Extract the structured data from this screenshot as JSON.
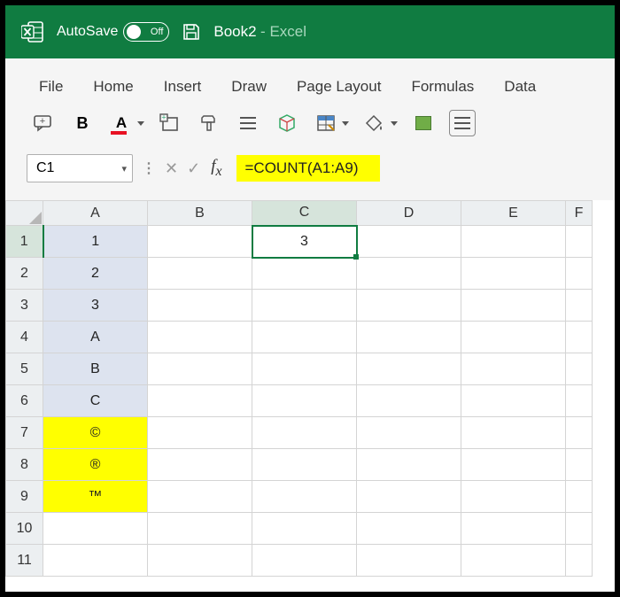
{
  "title": {
    "autosave": "AutoSave",
    "autosave_state": "Off",
    "book": "Book2",
    "app": "Excel"
  },
  "tabs": [
    "File",
    "Home",
    "Insert",
    "Draw",
    "Page Layout",
    "Formulas",
    "Data"
  ],
  "namebox": "C1",
  "formula": "=COUNT(A1:A9)",
  "columns": [
    "A",
    "B",
    "C",
    "D",
    "E",
    "F"
  ],
  "rows": [
    "1",
    "2",
    "3",
    "4",
    "5",
    "6",
    "7",
    "8",
    "9",
    "10",
    "11"
  ],
  "cells": {
    "A1": "1",
    "A2": "2",
    "A3": "3",
    "A4": "A",
    "A5": "B",
    "A6": "C",
    "A7": "©",
    "A8": "®",
    "A9": "™",
    "C1": "3"
  },
  "chart_data": {
    "type": "table",
    "title": "Excel worksheet with COUNT formula",
    "formula_cell": "C1",
    "formula": "=COUNT(A1:A9)",
    "formula_result": 3,
    "range": "A1:A9",
    "data": [
      {
        "cell": "A1",
        "value": "1",
        "kind": "number",
        "fill": "light-blue"
      },
      {
        "cell": "A2",
        "value": "2",
        "kind": "number",
        "fill": "light-blue"
      },
      {
        "cell": "A3",
        "value": "3",
        "kind": "number",
        "fill": "light-blue"
      },
      {
        "cell": "A4",
        "value": "A",
        "kind": "text",
        "fill": "light-blue"
      },
      {
        "cell": "A5",
        "value": "B",
        "kind": "text",
        "fill": "light-blue"
      },
      {
        "cell": "A6",
        "value": "C",
        "kind": "text",
        "fill": "light-blue"
      },
      {
        "cell": "A7",
        "value": "©",
        "kind": "symbol",
        "fill": "yellow"
      },
      {
        "cell": "A8",
        "value": "®",
        "kind": "symbol",
        "fill": "yellow"
      },
      {
        "cell": "A9",
        "value": "™",
        "kind": "symbol",
        "fill": "yellow"
      }
    ],
    "count_result": 3
  }
}
